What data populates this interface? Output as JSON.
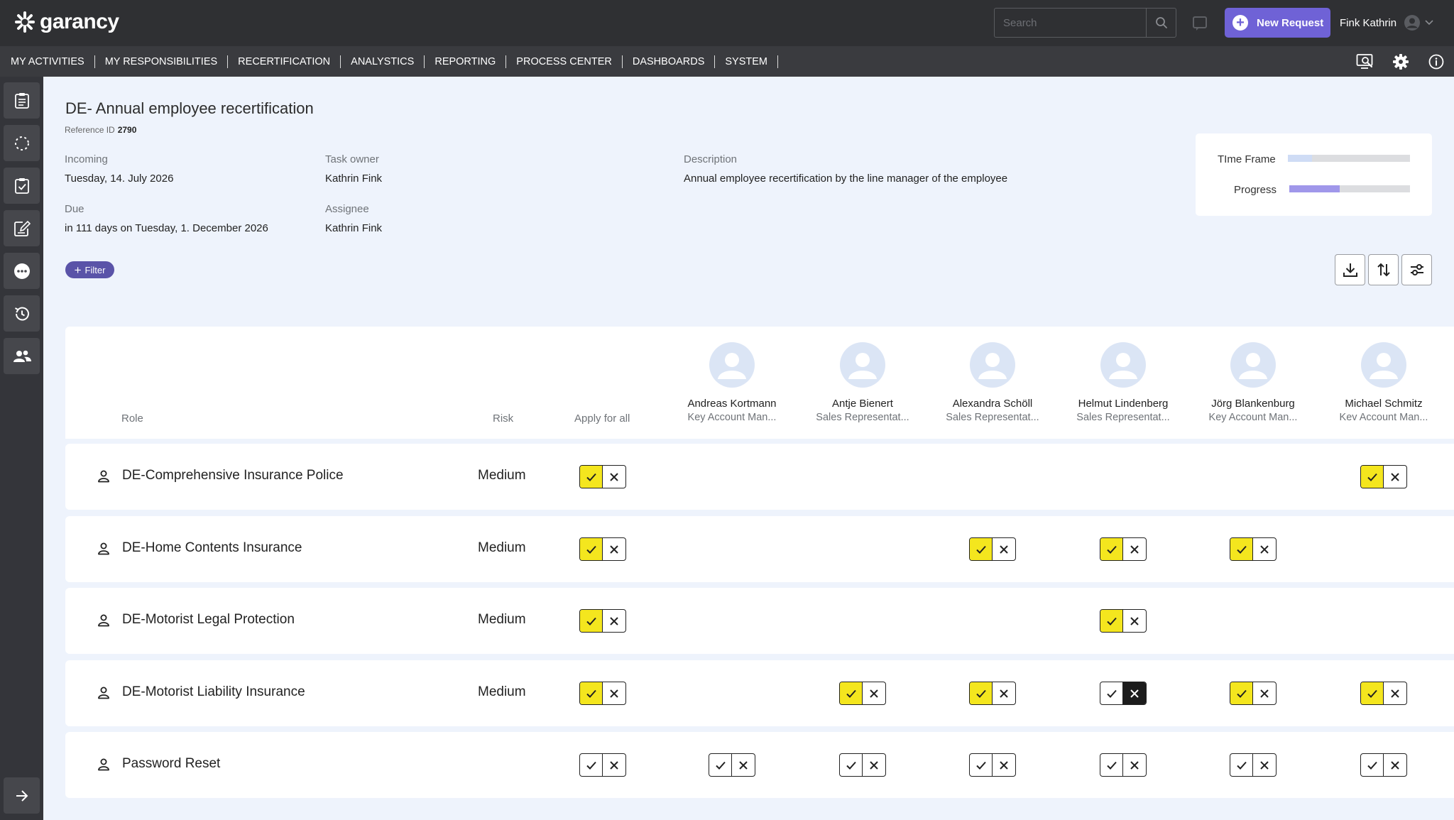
{
  "app": {
    "logo_text": "garancy",
    "colors": {
      "accent": "#6f62d6",
      "approve": "#f4e61e",
      "reject": "#1c1c1c",
      "topbar": "#2f3033"
    }
  },
  "header": {
    "search_placeholder": "Search",
    "new_request_label": "New Request",
    "user_name": "Fink Kathrin"
  },
  "nav": {
    "items": [
      "MY ACTIVITIES",
      "MY RESPONSIBILITIES",
      "RECERTIFICATION",
      "ANALYSTICS",
      "REPORTING",
      "PROCESS CENTER",
      "DASHBOARDS",
      "SYSTEM"
    ]
  },
  "task": {
    "title": "DE- Annual employee recertification",
    "reference_label": "Reference ID",
    "reference_value": "2790",
    "incoming_label": "Incoming",
    "incoming_value": "Tuesday, 14. July 2026",
    "due_label": "Due",
    "due_value": "in 111 days on Tuesday, 1. December 2026",
    "owner_label": "Task owner",
    "owner_value": "Kathrin Fink",
    "assignee_label": "Assignee",
    "assignee_value": "Kathrin Fink",
    "description_label": "Description",
    "description_value": "Annual employee recertification by the line manager of the employee",
    "timeframe_label": "TIme Frame",
    "timeframe_fraction": 0.2,
    "progress_label": "Progress",
    "progress_fraction": 0.42,
    "filter_label": "Filter"
  },
  "table": {
    "role_header": "Role",
    "risk_header": "Risk",
    "apply_all_header": "Apply for all",
    "users": [
      {
        "name": "Andreas Kortmann",
        "title": "Key Account Man..."
      },
      {
        "name": "Antje Bienert",
        "title": "Sales Representat..."
      },
      {
        "name": "Alexandra Schöll",
        "title": "Sales Representat..."
      },
      {
        "name": "Helmut Lindenberg",
        "title": "Sales Representat..."
      },
      {
        "name": "Jörg Blankenburg",
        "title": "Key Account Man..."
      },
      {
        "name": "Michael Schmitz",
        "title": "Kev Account Man..."
      }
    ],
    "rows": [
      {
        "role": "DE-Comprehensive Insurance Police",
        "risk": "Medium",
        "all": "approve",
        "cells": [
          "none",
          "none",
          "none",
          "none",
          "none",
          "approve"
        ]
      },
      {
        "role": "DE-Home Contents Insurance",
        "risk": "Medium",
        "all": "approve",
        "cells": [
          "none",
          "none",
          "approve",
          "approve",
          "approve",
          "none"
        ]
      },
      {
        "role": "DE-Motorist Legal Protection",
        "risk": "Medium",
        "all": "approve",
        "cells": [
          "none",
          "none",
          "none",
          "approve",
          "none",
          "none"
        ]
      },
      {
        "role": "DE-Motorist Liability Insurance",
        "risk": "Medium",
        "all": "approve",
        "cells": [
          "none",
          "approve",
          "approve",
          "reject",
          "approve",
          "approve"
        ]
      },
      {
        "role": "Password Reset",
        "risk": "",
        "all": "empty",
        "cells": [
          "empty",
          "empty",
          "empty",
          "empty",
          "empty",
          "empty"
        ]
      }
    ]
  }
}
